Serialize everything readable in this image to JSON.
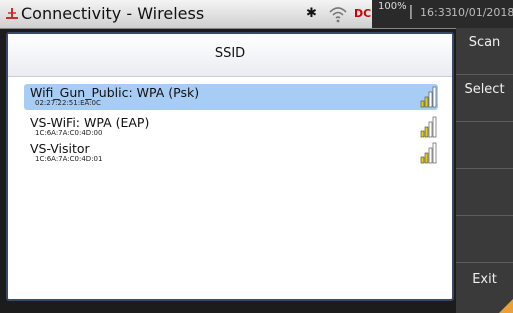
{
  "titlebar": {
    "title": "Connectivity - Wireless",
    "icons": [
      "app-logo-icon",
      "bluetooth-icon",
      "wifi-icon",
      "dc-power-icon",
      "battery-icon"
    ],
    "power_label": "DC",
    "battery_percent": "100%",
    "battery_level_pct": 45,
    "time": "16:33",
    "date": "10/01/2018"
  },
  "panel": {
    "title": "SSID"
  },
  "networks": [
    {
      "name": "Wifi_Gun_Public: WPA (Psk)",
      "mac": "02:27:22:51:EA:0C",
      "selected": true,
      "signal_bars": 4
    },
    {
      "name": "VS-WiFi: WPA (EAP)",
      "mac": "1C:6A:7A:C0:4D:00",
      "selected": false,
      "signal_bars": 4
    },
    {
      "name": "VS-Visitor",
      "mac": "1C:6A:7A:C0:4D:01",
      "selected": false,
      "signal_bars": 4
    }
  ],
  "softkeys": {
    "scan": "Scan",
    "select": "Select",
    "exit": "Exit"
  },
  "colors": {
    "selected_row": "#a8cdf4",
    "signal_fill": "#e6cf00",
    "battery_fill": "#3fb23f",
    "panel_border": "#3a4b6a"
  }
}
